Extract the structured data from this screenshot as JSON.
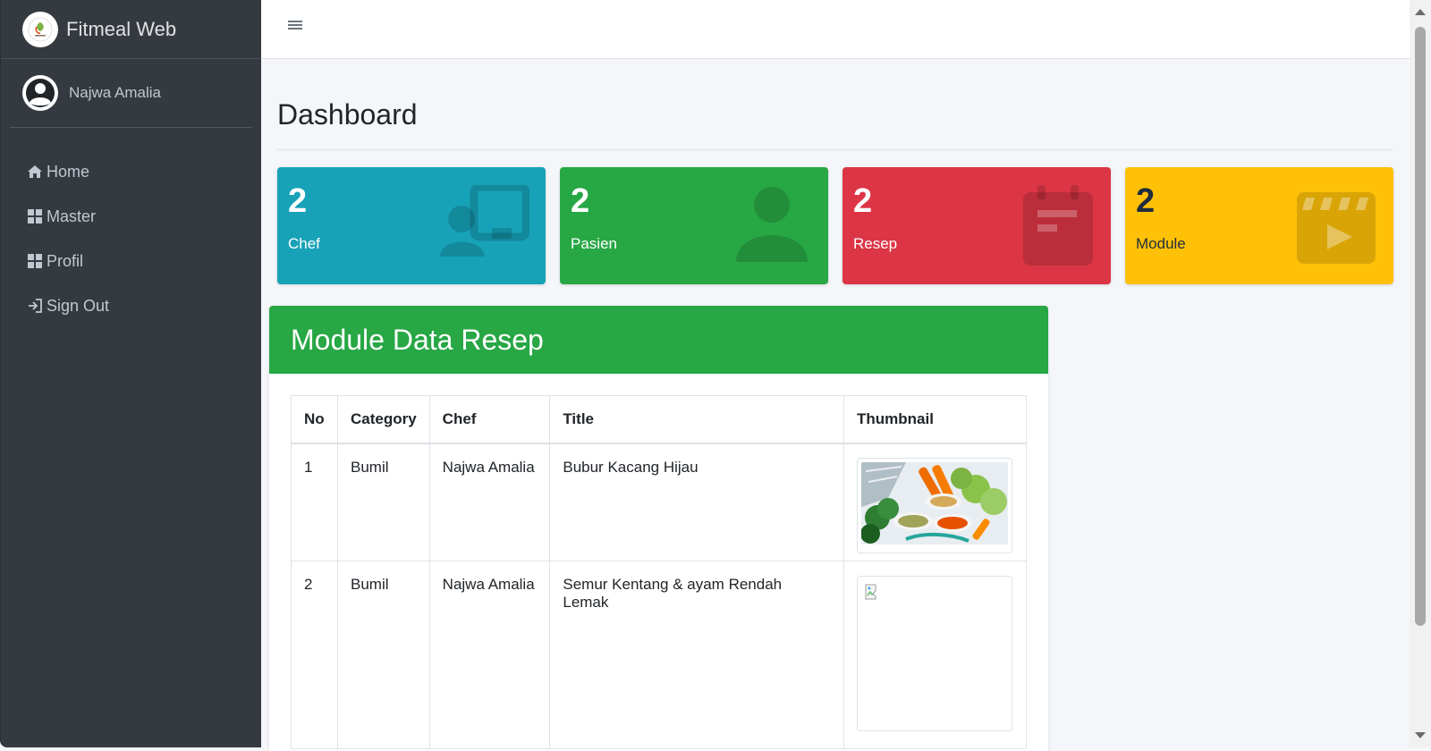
{
  "app": {
    "brand": "Fitmeal Web",
    "logo_icon": "leaf-logo-icon"
  },
  "user": {
    "name": "Najwa Amalia",
    "avatar_icon": "user-circle-icon"
  },
  "sidebar": {
    "items": [
      {
        "label": "Home",
        "icon": "home-icon"
      },
      {
        "label": "Master",
        "icon": "grid-icon"
      },
      {
        "label": "Profil",
        "icon": "grid-icon"
      },
      {
        "label": "Sign Out",
        "icon": "sign-out-icon"
      }
    ]
  },
  "topbar": {
    "menu_icon": "hamburger-icon"
  },
  "page": {
    "title": "Dashboard"
  },
  "stats": [
    {
      "value": "2",
      "label": "Chef",
      "color": "#17a2b8",
      "icon": "chalkboard-teacher-icon"
    },
    {
      "value": "2",
      "label": "Pasien",
      "color": "#28a745",
      "icon": "user-icon"
    },
    {
      "value": "2",
      "label": "Resep",
      "color": "#dc3545",
      "icon": "calendar-icon"
    },
    {
      "value": "2",
      "label": "Module",
      "color": "#ffc107",
      "icon": "film-icon"
    }
  ],
  "module": {
    "title": "Module Data Resep",
    "columns": [
      "No",
      "Category",
      "Chef",
      "Title",
      "Thumbnail"
    ],
    "rows": [
      {
        "no": "1",
        "category": "Bumil",
        "chef": "Najwa Amalia",
        "title": "Bubur Kacang Hijau",
        "thumbnail": "food-photo"
      },
      {
        "no": "2",
        "category": "Bumil",
        "chef": "Najwa Amalia",
        "title": "Semur Kentang & ayam Rendah Lemak",
        "thumbnail": "broken-image"
      }
    ]
  },
  "colors": {
    "sidebar": "#343a40",
    "accent_green": "#28a745",
    "background": "#f4f6f9"
  }
}
